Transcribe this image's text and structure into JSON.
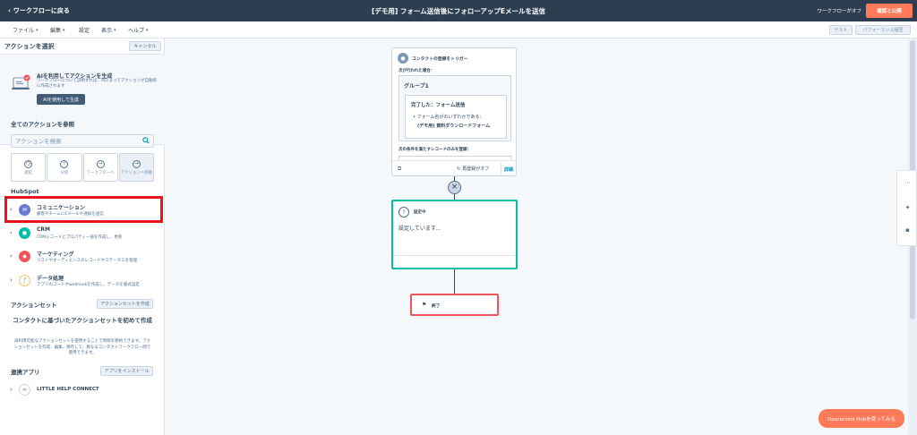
{
  "header": {
    "back_label": "ワークフローに戻る",
    "title": "[デモ用] フォーム送信後にフォローアップEメールを送信",
    "workflow_status": "ワークフローがオフ",
    "review_button": "確認と公開"
  },
  "menubar": {
    "items": [
      {
        "label": "ファイル"
      },
      {
        "label": "編集"
      },
      {
        "label": "設定"
      },
      {
        "label": "表示"
      },
      {
        "label": "ヘルプ"
      }
    ],
    "test_label": "テスト",
    "performance_label": "パフォーマンス履歴"
  },
  "panel": {
    "title": "アクションを選択",
    "cancel_label": "キャンセル",
    "ai": {
      "title": "AIを利用してアクションを生成",
      "description": "ワークフローについて説明すれば、AIによってアクションが自動的に作成されます",
      "button_label": "AIを使用して生成"
    },
    "browse_heading": "全てのアクションを参照",
    "search_placeholder": "アクションを検索",
    "categories": [
      {
        "label": "遅延"
      },
      {
        "label": "分岐"
      },
      {
        "label": "ワークフローへ"
      },
      {
        "label": "アクションへ移動"
      }
    ],
    "hubspot_heading": "HubSpot",
    "actions": [
      {
        "name": "コミュニケーション",
        "description": "顧客やチームにEメールや通知を送信"
      },
      {
        "name": "CRM",
        "description": "CRMレコードとプロパティー値を作成し、更新"
      },
      {
        "name": "マーケティング",
        "description": "リストやオーディエンスのレコードやステータスを管理"
      },
      {
        "name": "データ処理",
        "description": "アプリのコードやwebhookを作成し、データを書式設定"
      }
    ],
    "action_sets": {
      "heading": "アクションセット",
      "create_label": "アクションセットを作成",
      "title": "コンタクトに基づいたアクションセットを初めて作成",
      "description": "再利用可能なアクションセットを使用することで時間を節約できます。アクションセットを作成、編集、保存して、異なるコンタクトワークフロー間で使用できます。"
    },
    "apps": {
      "heading": "連携アプリ",
      "install_label": "アプリをインストール",
      "items": [
        {
          "name": "LITTLE HELP CONNECT"
        }
      ]
    }
  },
  "canvas": {
    "trigger": {
      "title": "コンタクトの登録をトリガー",
      "when_label": "次が行われた場合：",
      "group_title": "グループ1",
      "filter_title": "完了した：フォーム送信",
      "filter_line1": "フォーム名がのいずれかである：",
      "filter_line2": "(デモ用) 資料ダウンロードフォーム",
      "reenroll_condition": "次の条件を満たすレコードのみを登録：",
      "reenroll_status": "再登録がオフ",
      "detail_label": "詳細"
    },
    "pending": {
      "label": "設定中",
      "body": "設定しています..."
    },
    "end": {
      "label": "終了"
    }
  },
  "ops_button": "Operations Hubを使ってみる",
  "colors": {
    "header_bg": "#2d3e50",
    "accent": "#ff7a59",
    "teal": "#00bda5",
    "highlight": "#e8141b",
    "end_border": "#f2545b",
    "communication_icon": "#6a78d1",
    "crm_icon": "#00bda5",
    "marketing_icon": "#f2545b",
    "data_icon": "#f5c26b"
  }
}
